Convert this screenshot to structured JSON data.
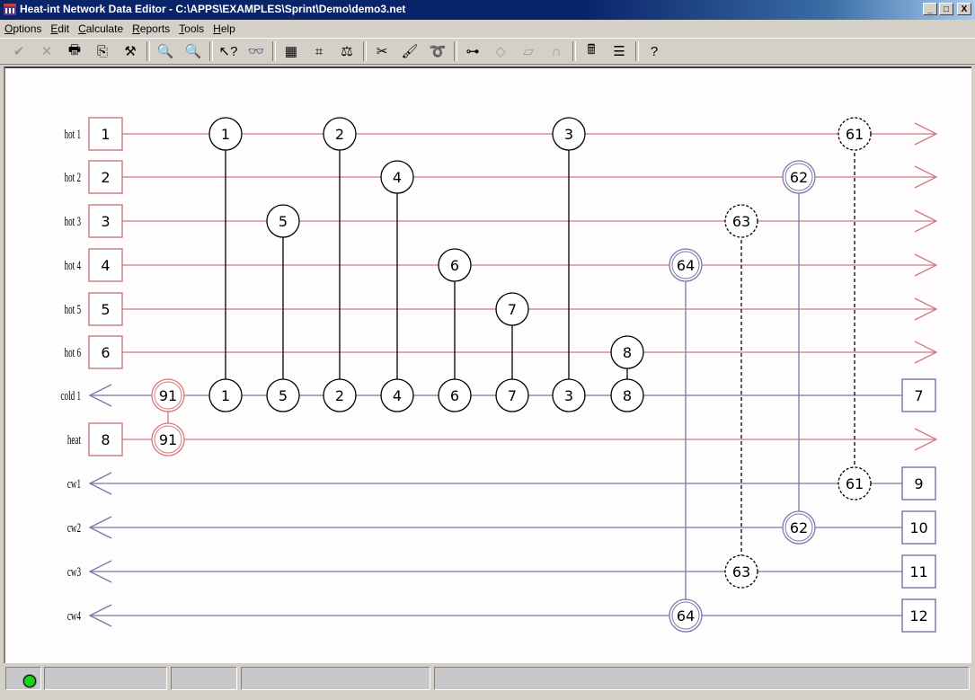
{
  "window": {
    "title": "Heat-int Network Data Editor - C:\\APPS\\EXAMPLES\\Sprint\\Demo\\demo3.net",
    "minimize_label": "_",
    "maximize_label": "□",
    "close_label": "X"
  },
  "menu": [
    {
      "label": "Options",
      "accel": "O"
    },
    {
      "label": "Edit",
      "accel": "E"
    },
    {
      "label": "Calculate",
      "accel": "C"
    },
    {
      "label": "Reports",
      "accel": "R"
    },
    {
      "label": "Tools",
      "accel": "T"
    },
    {
      "label": "Help",
      "accel": "H"
    }
  ],
  "toolbar": [
    {
      "name": "accept-icon",
      "glyph": "✔",
      "enabled": false
    },
    {
      "name": "cancel-icon",
      "glyph": "✕",
      "enabled": false
    },
    {
      "name": "print-icon",
      "glyph": "🖶",
      "enabled": true
    },
    {
      "name": "copy-icon",
      "glyph": "⎘",
      "enabled": true
    },
    {
      "name": "tools-icon",
      "glyph": "⚒",
      "enabled": true
    },
    {
      "sep": true
    },
    {
      "name": "zoom-icon",
      "glyph": "🔍",
      "enabled": true
    },
    {
      "name": "zoom-off-icon",
      "glyph": "🔍",
      "enabled": true
    },
    {
      "sep": true
    },
    {
      "name": "context-help-icon",
      "glyph": "↖?",
      "enabled": true
    },
    {
      "name": "find-icon",
      "glyph": "👓",
      "enabled": true
    },
    {
      "sep": true
    },
    {
      "name": "table-icon",
      "glyph": "▦",
      "enabled": true
    },
    {
      "name": "network-icon",
      "glyph": "⌗",
      "enabled": true
    },
    {
      "name": "balance-icon",
      "glyph": "⚖",
      "enabled": true
    },
    {
      "sep": true
    },
    {
      "name": "cut-icon",
      "glyph": "✂",
      "enabled": true
    },
    {
      "name": "brush-icon",
      "glyph": "🖌",
      "enabled": true
    },
    {
      "name": "lasso-icon",
      "glyph": "➰",
      "enabled": true
    },
    {
      "sep": true
    },
    {
      "name": "add-exchanger-icon",
      "glyph": "⊶",
      "enabled": true
    },
    {
      "name": "split-icon",
      "glyph": "◇",
      "enabled": false
    },
    {
      "name": "mixer-icon",
      "glyph": "⏥",
      "enabled": false
    },
    {
      "name": "curve-icon",
      "glyph": "∩",
      "enabled": false
    },
    {
      "sep": true
    },
    {
      "name": "calculator-icon",
      "glyph": "🖩",
      "enabled": true
    },
    {
      "name": "settings-icon",
      "glyph": "☰",
      "enabled": true
    },
    {
      "sep": true
    },
    {
      "name": "help-icon",
      "glyph": "?",
      "enabled": true
    }
  ],
  "diagram": {
    "colors": {
      "hot": "#d27a7a",
      "cold": "#7878a8",
      "match": "#000000",
      "box_hot": "#c07070",
      "box_cold": "#6868a0"
    },
    "hot_streams": [
      {
        "label": "hot 1",
        "id": "1"
      },
      {
        "label": "hot 2",
        "id": "2"
      },
      {
        "label": "hot 3",
        "id": "3"
      },
      {
        "label": "hot 4",
        "id": "4"
      },
      {
        "label": "hot 5",
        "id": "5"
      },
      {
        "label": "hot 6",
        "id": "6"
      }
    ],
    "cold_streams": [
      {
        "label": "cold 1",
        "id": "7"
      },
      {
        "label": "heat",
        "id": "8",
        "type": "hot-utility"
      },
      {
        "label": "cw1",
        "id": "9"
      },
      {
        "label": "cw2",
        "id": "10"
      },
      {
        "label": "cw3",
        "id": "11"
      },
      {
        "label": "cw4",
        "id": "12"
      }
    ],
    "matches": [
      {
        "id": "1",
        "hot_row": 0,
        "cold_row": 6,
        "col": 2,
        "style": "process"
      },
      {
        "id": "2",
        "hot_row": 0,
        "cold_row": 6,
        "col": 4,
        "style": "process"
      },
      {
        "id": "3",
        "hot_row": 0,
        "cold_row": 6,
        "col": 8,
        "style": "process"
      },
      {
        "id": "4",
        "hot_row": 1,
        "cold_row": 6,
        "col": 5,
        "style": "process"
      },
      {
        "id": "5",
        "hot_row": 2,
        "cold_row": 6,
        "col": 3,
        "style": "process"
      },
      {
        "id": "6",
        "hot_row": 3,
        "cold_row": 6,
        "col": 6,
        "style": "process"
      },
      {
        "id": "7",
        "hot_row": 4,
        "cold_row": 6,
        "col": 7,
        "style": "process"
      },
      {
        "id": "8",
        "hot_row": 5,
        "cold_row": 6,
        "col": 9,
        "style": "process"
      },
      {
        "id": "91",
        "hot_row": 7,
        "cold_row": 6,
        "col": 1,
        "style": "heater"
      },
      {
        "id": "61",
        "hot_row": 0,
        "cold_row": 8,
        "col": 14,
        "style": "cooler-dashed"
      },
      {
        "id": "62",
        "hot_row": 1,
        "cold_row": 9,
        "col": 13,
        "style": "cooler"
      },
      {
        "id": "63",
        "hot_row": 2,
        "cold_row": 10,
        "col": 12,
        "style": "cooler-dashed"
      },
      {
        "id": "64",
        "hot_row": 3,
        "cold_row": 11,
        "col": 11,
        "style": "cooler"
      }
    ]
  },
  "status": {
    "indicator": "ok",
    "indicator_color": "#19d219",
    "panels": [
      "",
      "",
      "",
      ""
    ]
  }
}
